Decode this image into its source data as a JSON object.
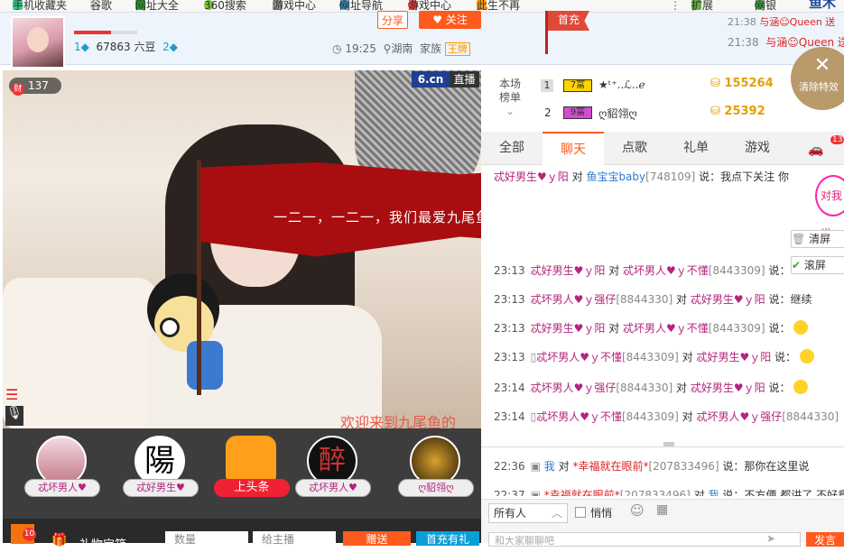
{
  "bookmarks": {
    "items": [
      "手机收藏夹",
      "谷歌",
      "网址大全",
      "360搜索",
      "游戏中心",
      "网址导航",
      "游戏中心",
      "此生不再"
    ],
    "right": [
      "扩展",
      "网银"
    ]
  },
  "header": {
    "bean_count": "67863 六豆",
    "level_left": "1",
    "level_right": "2",
    "time": "19:25",
    "location": "湖南",
    "family_label": "家族",
    "family_badge": "王牌",
    "share_label": "分享",
    "follow_label": "关注",
    "flag_label": "首充",
    "news": [
      {
        "time": "21:38",
        "text": "与涵☺Queen 送"
      },
      {
        "time": "21:38",
        "text": "与涵☺Queen 送"
      }
    ]
  },
  "video": {
    "wealth_badge": "财",
    "wealth_count": "137",
    "logo": "6.cn",
    "live_label": "直播",
    "banner_text": "一二一，一二一，我们最爱九尾鱼！",
    "welcome_text": "欢迎来到九尾鱼的"
  },
  "fans": [
    {
      "name": "忒坏男人♥"
    },
    {
      "name": "忒好男生♥"
    },
    {
      "name": "上头条"
    },
    {
      "name": "忒坏男人♥"
    },
    {
      "name": "ღ貂翎ღ"
    }
  ],
  "gift": {
    "badge_count": "10",
    "title": "礼物宝箱",
    "qty_placeholder": "数量",
    "target_placeholder": "给主播",
    "send_label": "赠送",
    "recharge_label": "首充有礼"
  },
  "ranking": {
    "label_line1": "本场",
    "label_line2": "榜单",
    "rows": [
      {
        "rank": "1",
        "badge": "7富",
        "name": "★ᵗ⁺..ℒ..ℯ",
        "amount": "155264"
      },
      {
        "rank": "2",
        "badge": "9富",
        "name": "ღ貂翎ღ",
        "amount": "25392"
      }
    ]
  },
  "close_panel": {
    "label": "清除特效"
  },
  "tabs": [
    "全部",
    "聊天",
    "点歌",
    "礼单",
    "游戏"
  ],
  "active_tab": "聊天",
  "tab_badge": "13",
  "side_buttons": {
    "talk": "对我说",
    "clear": "清屏",
    "scroll": "滚屏"
  },
  "chat": [
    {
      "time": "",
      "from": "忒好男生♥ｙ阳",
      "id": "",
      "verb": "对",
      "to": "鱼宝宝baby",
      "to_id": "[748109]",
      "text": "说：我点下关注 你"
    },
    {
      "time": "23:13",
      "from": "忒好男生♥ｙ阳",
      "id": "",
      "verb": "对",
      "to": "忒坏男人♥ｙ不懂",
      "to_id": "[8443309]",
      "text": "说："
    },
    {
      "time": "23:13",
      "from": "忒坏男人♥ｙ强仔",
      "id": "[8844330]",
      "verb": "对",
      "to": "忒好男生♥ｙ阳",
      "to_id": "",
      "text": "说：继续"
    },
    {
      "time": "23:13",
      "from": "忒好男生♥ｙ阳",
      "id": "",
      "verb": "对",
      "to": "忒坏男人♥ｙ不懂",
      "to_id": "[8443309]",
      "text": "说："
    },
    {
      "time": "23:13",
      "from": "忒坏男人♥ｙ不懂",
      "id": "[8443309]",
      "verb": "对",
      "to": "忒好男生♥ｙ阳",
      "to_id": "",
      "text": "说："
    },
    {
      "time": "23:14",
      "from": "忒坏男人♥ｙ强仔",
      "id": "[8844330]",
      "verb": "对",
      "to": "忒好男生♥ｙ阳",
      "to_id": "",
      "text": "说："
    },
    {
      "time": "23:14",
      "from": "忒坏男人♥ｙ不懂",
      "id": "[8443309]",
      "verb": "对",
      "to": "忒坏男人♥ｙ强仔",
      "to_id": "[8844330]",
      "text": ""
    }
  ],
  "chat_private": [
    {
      "time": "22:36",
      "from": "我",
      "verb": "对",
      "to": "*幸福就在眼前*",
      "to_id": "[207833496]",
      "text": "说：那你在这里说"
    },
    {
      "time": "22:37",
      "from": "*幸福就在眼前*",
      "id": "[207833496]",
      "verb": "对",
      "to": "我",
      "to_id": "",
      "text": "说：不方便 都讲了 不好意"
    }
  ],
  "input": {
    "target": "所有人",
    "whisper_label": "悄悄",
    "placeholder": "和大家聊聊吧",
    "send_label": "发言"
  },
  "colors": {
    "accent": "#ff5a1e",
    "nick": "#b4237d",
    "banner": "#a80d10"
  }
}
